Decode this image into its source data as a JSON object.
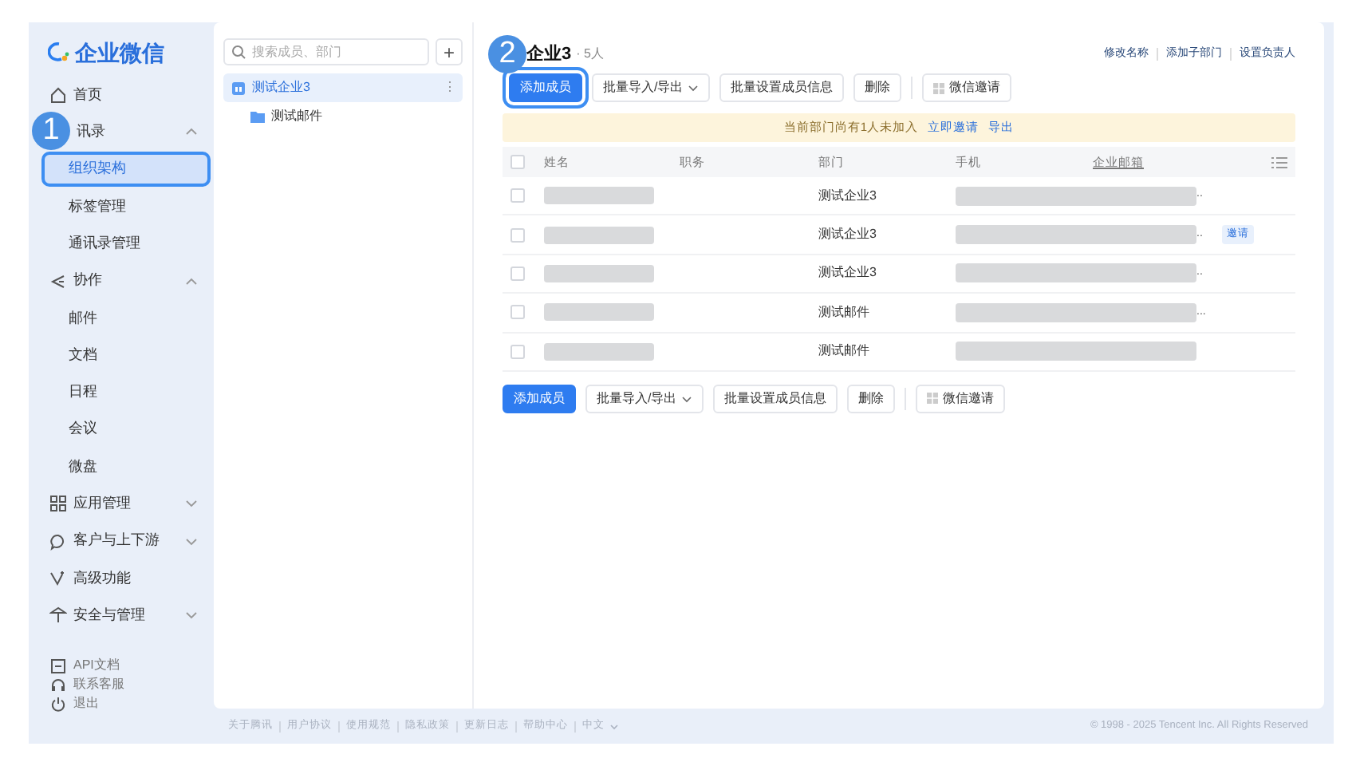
{
  "logo": {
    "text": "企业微信"
  },
  "sidebar": {
    "items": [
      {
        "label": "首页",
        "selected": false
      },
      {
        "label": "讯录",
        "expanded": true,
        "children": [
          {
            "label": "组织架构",
            "selected": true
          },
          {
            "label": "标签管理",
            "selected": false
          },
          {
            "label": "通讯录管理",
            "selected": false
          }
        ]
      },
      {
        "label": "协作",
        "expanded": true,
        "children": [
          {
            "label": "邮件",
            "selected": false
          },
          {
            "label": "文档",
            "selected": false
          },
          {
            "label": "日程",
            "selected": false
          },
          {
            "label": "会议",
            "selected": false
          },
          {
            "label": "微盘",
            "selected": false
          }
        ]
      },
      {
        "label": "应用管理",
        "expanded": false
      },
      {
        "label": "客户与上下游",
        "expanded": false
      },
      {
        "label": "高级功能",
        "selected": false
      },
      {
        "label": "安全与管理",
        "expanded": false
      }
    ],
    "bottom": [
      {
        "label": "API文档"
      },
      {
        "label": "联系客服"
      },
      {
        "label": "退出"
      }
    ]
  },
  "tree": {
    "search_placeholder": "搜索成员、部门",
    "add": "+",
    "items": [
      {
        "label": "测试企业3",
        "selected": true,
        "more": "⋮",
        "children": [
          {
            "label": "测试邮件",
            "selected": false
          }
        ]
      }
    ]
  },
  "header": {
    "title": "企业3",
    "count": "· 5人",
    "links": [
      "修改名称",
      "添加子部门",
      "设置负责人"
    ]
  },
  "toolbar": [
    "添加成员",
    "批量导入/导出",
    "批量设置成员信息",
    "删除",
    "微信邀请"
  ],
  "notice": {
    "text": "当前部门尚有1人未加入",
    "links": [
      "立即邀请",
      "导出"
    ]
  },
  "table": {
    "select_all": {
      "checked": false
    },
    "columns": [
      "姓名",
      "职务",
      "部门",
      "手机",
      "企业邮箱"
    ],
    "rows": [
      {
        "checked": false,
        "department": "测试企业3",
        "suffix": "..",
        "tag": ""
      },
      {
        "checked": false,
        "department": "测试企业3",
        "suffix": "..",
        "tag": "邀请"
      },
      {
        "checked": false,
        "department": "测试企业3",
        "suffix": "..",
        "tag": ""
      },
      {
        "checked": false,
        "department": "测试邮件",
        "suffix": "...",
        "tag": ""
      },
      {
        "checked": false,
        "department": "测试邮件",
        "suffix": "",
        "tag": ""
      }
    ]
  },
  "bottom_toolbar": [
    "添加成员",
    "批量导入/导出",
    "批量设置成员信息",
    "删除",
    "微信邀请"
  ],
  "footer": {
    "links": [
      "关于腾讯",
      "用户协议",
      "使用规范",
      "隐私政策",
      "更新日志",
      "帮助中心",
      "中文"
    ],
    "copyright": "© 1998 - 2025 Tencent Inc. All Rights Reserved"
  },
  "steps": [
    "1",
    "2"
  ]
}
